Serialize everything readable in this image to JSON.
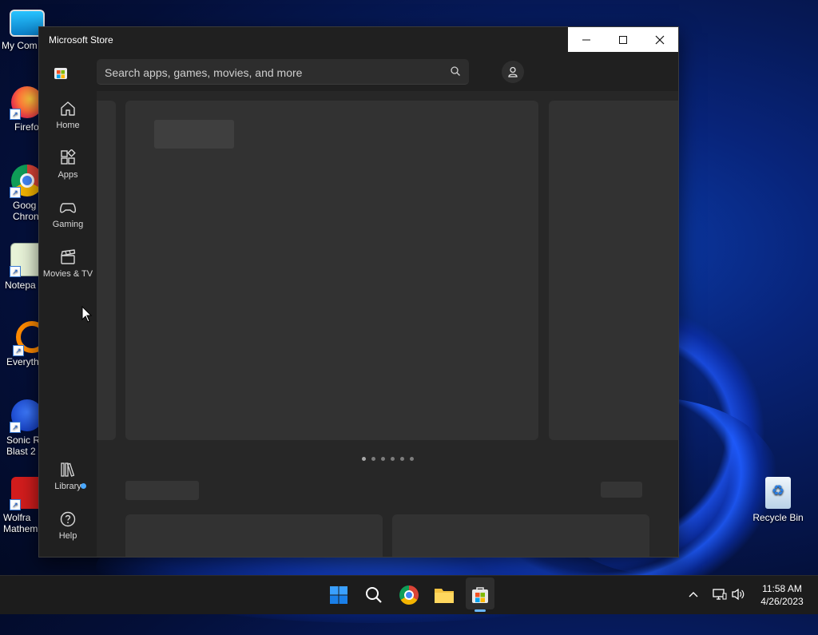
{
  "desktop": {
    "icons": [
      {
        "label": "My Com",
        "icon": "monitor-icon"
      },
      {
        "label": "Firefo",
        "icon": "firefox-icon"
      },
      {
        "label": "Goog\nChron",
        "icon": "chrome-icon"
      },
      {
        "label": "Notepa",
        "icon": "notepad-icon"
      },
      {
        "label": "Everyth",
        "icon": "everything-search-icon"
      },
      {
        "label": "Sonic R\nBlast 2",
        "icon": "sonic-icon"
      },
      {
        "label": "Wolfra\nMathem",
        "icon": "wolfram-icon"
      }
    ],
    "recycle_bin": {
      "label": "Recycle Bin",
      "icon": "recycle-bin-icon"
    }
  },
  "window": {
    "title": "Microsoft Store",
    "controls": {
      "minimize": "minimize-icon",
      "maximize": "maximize-icon",
      "close": "close-icon"
    }
  },
  "sidebar": {
    "logo": "store-logo-icon",
    "items": [
      {
        "label": "Home",
        "icon": "home-icon"
      },
      {
        "label": "Apps",
        "icon": "apps-icon"
      },
      {
        "label": "Gaming",
        "icon": "gamepad-icon"
      },
      {
        "label": "Movies & TV",
        "icon": "clapperboard-icon"
      }
    ],
    "bottom_items": [
      {
        "label": "Library",
        "icon": "library-icon",
        "has_badge": true
      },
      {
        "label": "Help",
        "icon": "help-icon"
      }
    ]
  },
  "search": {
    "placeholder": "Search apps, games, movies, and more",
    "icon": "search-icon"
  },
  "account": {
    "icon": "account-icon"
  },
  "carousel": {
    "slide_count": 6,
    "active_index": 0
  },
  "taskbar": {
    "apps": [
      {
        "name": "start",
        "icon": "windows-start-icon"
      },
      {
        "name": "search",
        "icon": "search-icon"
      },
      {
        "name": "chrome",
        "icon": "chrome-icon"
      },
      {
        "name": "file-explorer",
        "icon": "folder-icon"
      },
      {
        "name": "microsoft-store",
        "icon": "store-icon",
        "active": true
      }
    ],
    "tray": {
      "chevron": "chevron-up-icon",
      "network": "network-icon",
      "volume": "volume-icon"
    },
    "clock": {
      "time": "11:58 AM",
      "date": "4/26/2023"
    }
  },
  "colors": {
    "window_bg": "#202020",
    "content_bg": "#272727",
    "accent": "#4aa8ff"
  }
}
